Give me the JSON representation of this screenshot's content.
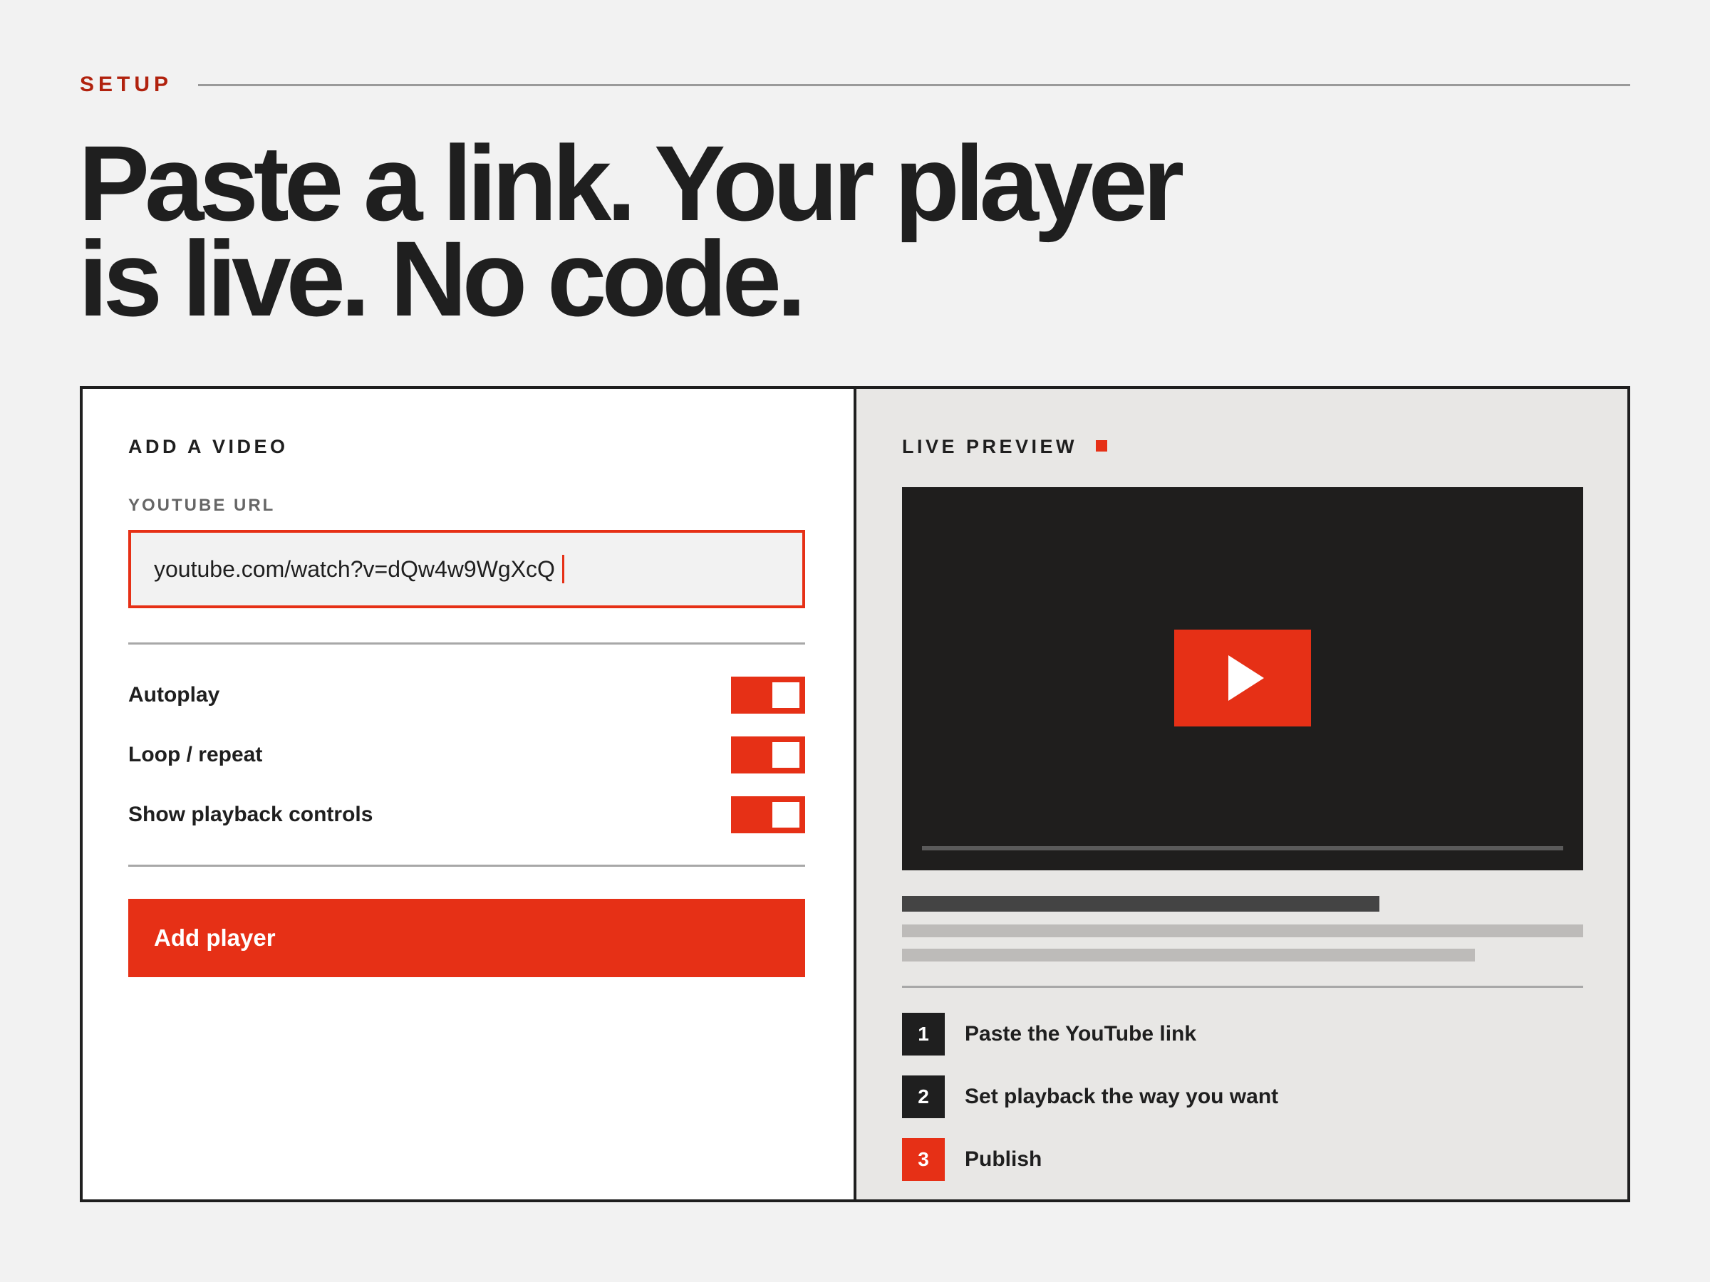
{
  "eyebrow": "SETUP",
  "headline": {
    "line1": "Paste a link. Your player",
    "line2": "is live. No code."
  },
  "add_video": {
    "title": "ADD A VIDEO",
    "url_label": "YOUTUBE URL",
    "url_value": "youtube.com/watch?v=dQw4w9WgXcQ",
    "options": [
      {
        "label": "Autoplay",
        "enabled": true
      },
      {
        "label": "Loop / repeat",
        "enabled": true
      },
      {
        "label": "Show playback controls",
        "enabled": true
      }
    ],
    "button_label": "Add player"
  },
  "preview": {
    "title": "LIVE PREVIEW",
    "steps": [
      {
        "number": "1",
        "label": "Paste the YouTube link",
        "active": false
      },
      {
        "number": "2",
        "label": "Set playback the way you want",
        "active": false
      },
      {
        "number": "3",
        "label": "Publish",
        "active": true
      }
    ]
  },
  "icons": {
    "play": "play-icon",
    "live_indicator": "live-indicator-icon"
  },
  "colors": {
    "accent": "#e63016",
    "eyebrow": "#b1220e",
    "ink": "#1f1f1f",
    "page_bg": "#f2f2f2",
    "preview_bg": "#e8e7e5",
    "video_bg": "#1f1e1d"
  }
}
